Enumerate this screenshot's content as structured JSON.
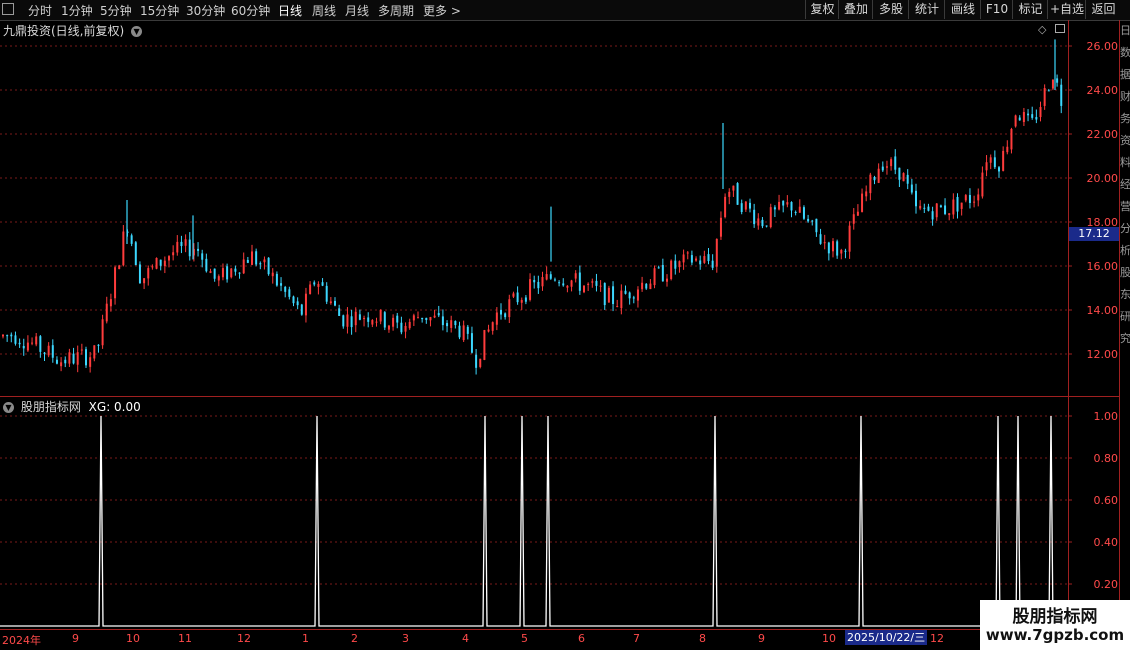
{
  "toolbar": {
    "periods": [
      "分时",
      "1分钟",
      "5分钟",
      "15分钟",
      "30分钟",
      "60分钟",
      "日线",
      "周线",
      "月线",
      "多周期",
      "更多"
    ],
    "active_period": "日线",
    "right_buttons": [
      "复权",
      "叠加",
      "多股",
      "统计",
      "画线",
      "F10",
      "标记",
      "+自选",
      "返回"
    ]
  },
  "main_chart": {
    "title": "九鼎投资(日线,前复权)",
    "y_ticks": [
      "26.00",
      "24.00",
      "22.00",
      "20.00",
      "18.00",
      "16.00",
      "14.00",
      "12.00"
    ],
    "current_price": "17.12",
    "y_range": [
      10.0,
      27.0
    ],
    "trend_keypoints": [
      [
        0,
        12.8
      ],
      [
        12,
        12.9
      ],
      [
        30,
        12.5
      ],
      [
        60,
        11.7
      ],
      [
        95,
        12.0
      ],
      [
        112,
        15.2
      ],
      [
        126,
        18.0
      ],
      [
        140,
        15.4
      ],
      [
        170,
        16.6
      ],
      [
        195,
        16.9
      ],
      [
        215,
        15.3
      ],
      [
        250,
        16.5
      ],
      [
        270,
        15.6
      ],
      [
        300,
        13.8
      ],
      [
        315,
        15.5
      ],
      [
        340,
        13.6
      ],
      [
        370,
        13.8
      ],
      [
        400,
        13.2
      ],
      [
        420,
        13.8
      ],
      [
        460,
        13.1
      ],
      [
        475,
        11.8
      ],
      [
        495,
        13.8
      ],
      [
        530,
        15.0
      ],
      [
        555,
        15.6
      ],
      [
        590,
        15.0
      ],
      [
        615,
        14.4
      ],
      [
        640,
        15.2
      ],
      [
        690,
        16.3
      ],
      [
        712,
        16.2
      ],
      [
        725,
        19.6
      ],
      [
        760,
        18.0
      ],
      [
        790,
        18.8
      ],
      [
        820,
        17.2
      ],
      [
        840,
        16.6
      ],
      [
        860,
        18.8
      ],
      [
        880,
        20.8
      ],
      [
        900,
        20.3
      ],
      [
        915,
        18.5
      ],
      [
        945,
        18.6
      ],
      [
        975,
        19.2
      ],
      [
        985,
        21.0
      ],
      [
        1000,
        20.7
      ],
      [
        1015,
        23.1
      ],
      [
        1030,
        22.3
      ],
      [
        1052,
        24.8
      ],
      [
        1062,
        23.3
      ]
    ],
    "special_bars": [
      [
        551,
        16.2,
        18.7
      ],
      [
        723,
        19.5,
        22.5
      ],
      [
        1055,
        24.0,
        26.3
      ],
      [
        127,
        17.0,
        19.0
      ],
      [
        193,
        16.3,
        18.3
      ]
    ],
    "colors": {
      "up": "#ff3c3c",
      "down": "#3cd8ff",
      "grid": "#7a1a1a",
      "axis": "#a02020"
    }
  },
  "indicator": {
    "title": "股朋指标网",
    "label": "XG: 0.00",
    "y_ticks": [
      "1.00",
      "0.80",
      "0.60",
      "0.40",
      "0.20"
    ],
    "signal_days": [
      101,
      317,
      485,
      522,
      548,
      715,
      861,
      998,
      1018,
      1051
    ],
    "signal_value": 1.0,
    "line_color": "#ffffff"
  },
  "time_axis": {
    "labels": [
      "2024年",
      "9",
      "10",
      "11",
      "12",
      "1",
      "2",
      "3",
      "4",
      "5",
      "6",
      "7",
      "8",
      "9",
      "10",
      "12"
    ],
    "cursor_date": "2025/10/22/三"
  },
  "watermark": {
    "title": "股朋指标网",
    "url": "www.7gpzb.com"
  },
  "right_strip_text": "日数据财务资料经营分析股东研究"
}
